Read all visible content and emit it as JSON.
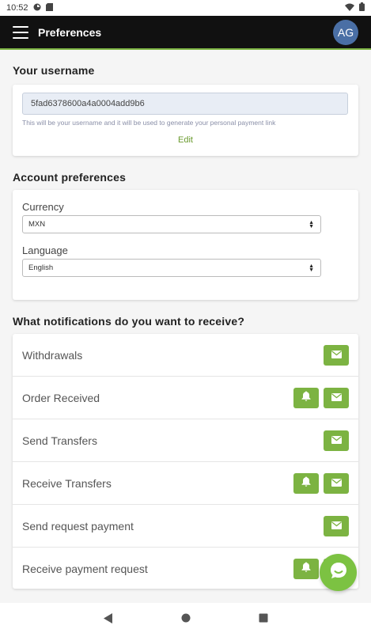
{
  "status": {
    "time": "10:52"
  },
  "header": {
    "title": "Preferences",
    "avatar_initials": "AG"
  },
  "username": {
    "section_title": "Your username",
    "value": "5fad6378600a4a0004add9b6",
    "help": "This will be your username and it will be used to generate your personal payment link",
    "edit_label": "Edit"
  },
  "account": {
    "section_title": "Account preferences",
    "currency_label": "Currency",
    "currency_value": "MXN",
    "language_label": "Language",
    "language_value": "English"
  },
  "notifications": {
    "section_title": "What notifications do you want to receive?",
    "items": [
      {
        "label": "Withdrawals",
        "buttons": [
          "email-icon"
        ]
      },
      {
        "label": "Order Received",
        "buttons": [
          "bell-icon",
          "email-icon"
        ]
      },
      {
        "label": "Send Transfers",
        "buttons": [
          "email-icon"
        ]
      },
      {
        "label": "Receive Transfers",
        "buttons": [
          "bell-icon",
          "email-icon"
        ]
      },
      {
        "label": "Send request payment",
        "buttons": [
          "email-icon"
        ]
      },
      {
        "label": "Receive payment request",
        "buttons": [
          "bell-icon",
          "email-icon"
        ]
      }
    ]
  },
  "colors": {
    "accent": "#7cb342",
    "app_bar": "#111111",
    "avatar": "#4a6fa5"
  }
}
